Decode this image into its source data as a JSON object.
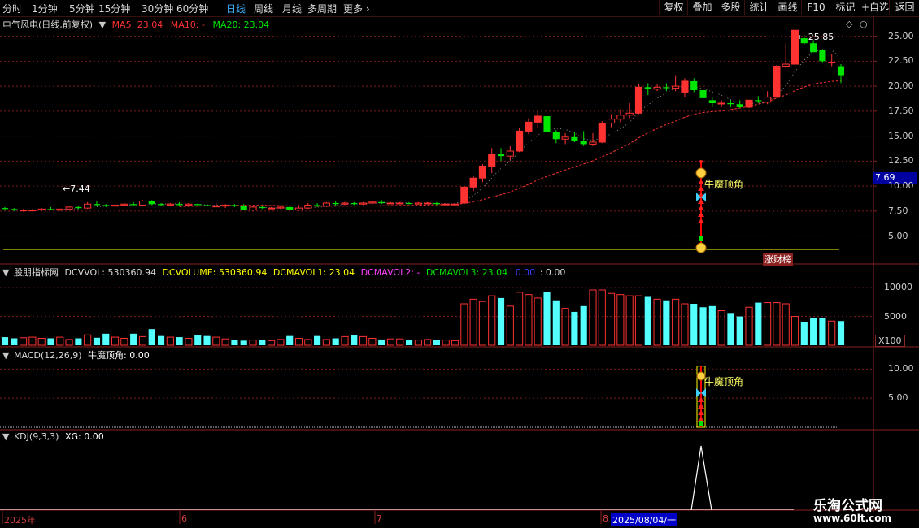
{
  "toolbar": {
    "tabs": [
      "分时",
      "1分钟",
      "5分钟",
      "15分钟",
      "30分钟",
      "60分钟",
      "日线",
      "周线",
      "月线",
      "多周期",
      "更多"
    ],
    "active_tab": "日线",
    "right_buttons": [
      "复权",
      "叠加",
      "多股",
      "统计",
      "画线",
      "F10",
      "标记",
      "+自选",
      "返回"
    ]
  },
  "main_panel": {
    "title": "电气风电(日线,前复权)",
    "ma5": "MA5: 23.04",
    "ma10": "MA10: -",
    "ma20": "MA20: 23.04",
    "high_label": "25.85",
    "low_label": "7.44",
    "price_tag": "7.69",
    "signal_label": "牛魔顶角",
    "badge": "涨财榜",
    "y_ticks": [
      "25.00",
      "22.50",
      "20.00",
      "17.50",
      "15.00",
      "12.50",
      "10.00",
      "7.50",
      "5.00"
    ]
  },
  "volume_panel": {
    "title": "股朋指标网",
    "dcvvol": "DCVVOL: 530360.94",
    "dcvolume": "DCVOLUME: 530360.94",
    "dcmavol1": "DCMAVOL1: 23.04",
    "dcmavol2": "DCMAVOL2: -",
    "dcmavol3": "DCMAVOL3: 23.04",
    "v1": "0.00",
    "v2": ": 0.00",
    "y_ticks": [
      "10000",
      "5000"
    ],
    "unit": "X100"
  },
  "macd_panel": {
    "title": "MACD(12,26,9)",
    "value": "牛魔顶角: 0.00",
    "signal_label": "牛魔顶角",
    "y_ticks": [
      "10.00",
      "5.00"
    ]
  },
  "kdj_panel": {
    "title": "KDJ(9,3,3)",
    "value": "XG: 0.00"
  },
  "date_axis": {
    "labels": [
      "2025年",
      "6",
      "7",
      "8"
    ],
    "cursor_date": "2025/08/04/一"
  },
  "watermark": {
    "name": "乐淘公式网",
    "url": "www.60lt.com"
  },
  "colors": {
    "up": "#ff3232",
    "down": "#00e600",
    "volume_down": "#54ffff",
    "ma5": "#ffffff",
    "ma20": "#ff3232",
    "grid": "#7a1a1a"
  },
  "chart_data": {
    "type": "candlestick",
    "y_range": [
      2.2,
      27.0
    ],
    "candles": [
      [
        7.8,
        7.9,
        7.6,
        7.7
      ],
      [
        7.7,
        7.8,
        7.5,
        7.6
      ],
      [
        7.6,
        7.7,
        7.44,
        7.6
      ],
      [
        7.6,
        7.7,
        7.5,
        7.6
      ],
      [
        7.6,
        7.8,
        7.5,
        7.7
      ],
      [
        7.7,
        7.9,
        7.6,
        7.6
      ],
      [
        7.6,
        7.7,
        7.5,
        7.7
      ],
      [
        7.7,
        8.0,
        7.6,
        7.9
      ],
      [
        7.9,
        8.0,
        7.7,
        7.8
      ],
      [
        7.8,
        8.4,
        7.7,
        8.2
      ],
      [
        8.2,
        8.5,
        8.0,
        8.1
      ],
      [
        8.1,
        8.2,
        7.9,
        8.0
      ],
      [
        8.0,
        8.2,
        7.9,
        8.1
      ],
      [
        8.1,
        8.3,
        8.0,
        8.2
      ],
      [
        8.2,
        8.4,
        8.0,
        8.1
      ],
      [
        8.1,
        8.6,
        8.0,
        8.5
      ],
      [
        8.5,
        8.6,
        8.1,
        8.2
      ],
      [
        8.2,
        8.3,
        8.0,
        8.1
      ],
      [
        8.1,
        8.3,
        8.0,
        8.2
      ],
      [
        8.2,
        8.4,
        8.0,
        8.1
      ],
      [
        8.1,
        8.3,
        8.0,
        8.2
      ],
      [
        8.2,
        8.3,
        8.0,
        8.1
      ],
      [
        8.1,
        8.2,
        7.9,
        8.0
      ],
      [
        8.0,
        8.3,
        7.9,
        8.0
      ],
      [
        8.0,
        8.2,
        7.8,
        8.1
      ],
      [
        8.1,
        8.2,
        7.9,
        8.0
      ],
      [
        8.0,
        8.2,
        7.6,
        7.6
      ],
      [
        7.6,
        8.0,
        7.5,
        7.9
      ],
      [
        7.9,
        8.0,
        7.7,
        7.8
      ],
      [
        7.8,
        7.9,
        7.7,
        7.8
      ],
      [
        7.8,
        8.0,
        7.7,
        7.9
      ],
      [
        7.9,
        8.0,
        7.6,
        7.6
      ],
      [
        7.6,
        8.1,
        7.5,
        7.8
      ],
      [
        7.8,
        8.3,
        7.7,
        8.1
      ],
      [
        8.1,
        8.3,
        7.9,
        8.0
      ],
      [
        8.0,
        8.4,
        7.9,
        8.3
      ],
      [
        8.3,
        8.5,
        8.0,
        8.2
      ],
      [
        8.2,
        8.4,
        8.1,
        8.3
      ],
      [
        8.3,
        8.4,
        8.1,
        8.2
      ],
      [
        8.2,
        8.4,
        8.1,
        8.3
      ],
      [
        8.3,
        8.5,
        8.2,
        8.4
      ],
      [
        8.4,
        8.6,
        8.2,
        8.3
      ],
      [
        8.3,
        8.4,
        8.2,
        8.3
      ],
      [
        8.3,
        8.4,
        8.2,
        8.3
      ],
      [
        8.3,
        8.4,
        8.2,
        8.2
      ],
      [
        8.2,
        8.4,
        8.2,
        8.3
      ],
      [
        8.3,
        8.4,
        8.2,
        8.3
      ],
      [
        8.3,
        8.4,
        8.1,
        8.2
      ],
      [
        8.2,
        8.3,
        8.1,
        8.2
      ],
      [
        8.2,
        8.3,
        8.1,
        8.2
      ],
      [
        8.3,
        10.0,
        8.2,
        9.9
      ],
      [
        9.9,
        11.0,
        9.5,
        10.8
      ],
      [
        10.8,
        12.2,
        10.4,
        12.0
      ],
      [
        12.0,
        13.8,
        11.3,
        13.2
      ],
      [
        13.2,
        13.8,
        12.5,
        13.0
      ],
      [
        13.0,
        14.0,
        12.6,
        13.5
      ],
      [
        13.5,
        15.8,
        13.4,
        15.5
      ],
      [
        15.5,
        16.8,
        15.2,
        16.4
      ],
      [
        16.4,
        17.5,
        15.8,
        17.0
      ],
      [
        17.0,
        17.6,
        15.3,
        15.4
      ],
      [
        15.4,
        15.6,
        14.3,
        14.7
      ],
      [
        14.7,
        15.3,
        14.2,
        14.9
      ],
      [
        14.9,
        15.4,
        14.4,
        14.5
      ],
      [
        14.5,
        15.5,
        14.0,
        14.2
      ],
      [
        14.2,
        15.3,
        14.0,
        14.4
      ],
      [
        14.4,
        16.5,
        14.3,
        16.3
      ],
      [
        16.3,
        17.2,
        15.9,
        16.7
      ],
      [
        16.7,
        17.7,
        16.4,
        17.1
      ],
      [
        17.1,
        18.3,
        16.8,
        17.3
      ],
      [
        17.3,
        20.2,
        17.2,
        19.9
      ],
      [
        19.9,
        20.3,
        19.1,
        19.7
      ],
      [
        19.7,
        20.2,
        19.5,
        19.9
      ],
      [
        19.9,
        20.3,
        19.5,
        19.8
      ],
      [
        19.8,
        21.1,
        19.5,
        20.0
      ],
      [
        19.4,
        20.8,
        18.9,
        20.5
      ],
      [
        20.5,
        20.8,
        19.4,
        19.6
      ],
      [
        19.6,
        20.0,
        18.6,
        18.8
      ],
      [
        18.6,
        18.9,
        17.9,
        18.3
      ],
      [
        18.3,
        18.6,
        17.9,
        18.3
      ],
      [
        18.3,
        18.6,
        17.9,
        18.2
      ],
      [
        18.2,
        18.6,
        17.8,
        17.9
      ],
      [
        17.9,
        18.6,
        17.8,
        18.6
      ],
      [
        18.6,
        19.0,
        18.3,
        18.5
      ],
      [
        18.4,
        19.5,
        18.2,
        18.9
      ],
      [
        18.9,
        22.1,
        18.9,
        22.0
      ],
      [
        22.0,
        24.3,
        21.8,
        22.2
      ],
      [
        22.2,
        25.85,
        22.0,
        25.6
      ],
      [
        24.8,
        25.1,
        24.2,
        24.3
      ],
      [
        24.3,
        24.6,
        23.4,
        23.4
      ],
      [
        23.6,
        23.7,
        22.4,
        22.5
      ],
      [
        22.4,
        23.2,
        22.0,
        22.4
      ],
      [
        22.0,
        22.2,
        20.3,
        21.1
      ]
    ],
    "volume": [
      14,
      12,
      13,
      14,
      12,
      12,
      14,
      10,
      12,
      18,
      13,
      20,
      14,
      12,
      20,
      15,
      28,
      16,
      14,
      14,
      12,
      17,
      16,
      14,
      11,
      9,
      8,
      9,
      9,
      8,
      10,
      16,
      12,
      10,
      16,
      10,
      12,
      15,
      18,
      15,
      12,
      10,
      11,
      11,
      9,
      9,
      10,
      9,
      9,
      8,
      72,
      80,
      76,
      86,
      82,
      68,
      92,
      88,
      82,
      92,
      78,
      64,
      58,
      68,
      96,
      96,
      90,
      88,
      86,
      86,
      84,
      80,
      78,
      80,
      72,
      72,
      66,
      68,
      60,
      56,
      50,
      66,
      74,
      74,
      74,
      72,
      50,
      40,
      47,
      47,
      42,
      42
    ]
  }
}
